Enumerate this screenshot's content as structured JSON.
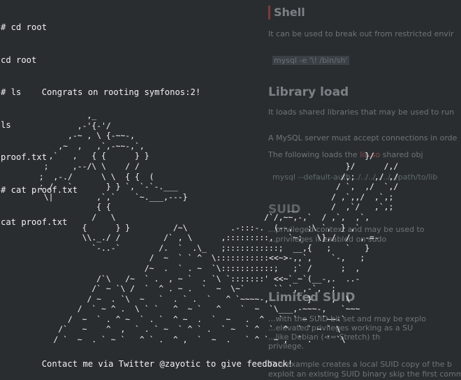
{
  "background_doc": {
    "shell_heading": "Shell",
    "shell_text": "It can be used to break out from restricted envir",
    "shell_code": "mysql -e '\\! /bin/sh'",
    "library_heading": "Library load",
    "library_text": "It loads shared libraries that may be used to run",
    "library_text2": "A MySQL server must accept connections in orde",
    "library_text3a": "The following loads the ",
    "library_text3b": "shared obj",
    "library_text3b_code": "lib.so",
    "library_code": "mysql --default-auth ../../../../../../path/to/lib",
    "suid_heading": "SUID",
    "suid_text": "...privileged context and may be used to",
    "suid_text2": "...privileges if enabled on sudo",
    "limited_heading": "Limited SUID",
    "limited_text1": "...with the SUID bit set and may be explo",
    "limited_text2": "...elevated privileges working as a SU",
    "limited_text3": "...like Debian (<= Stretch) th",
    "limited_text4": "privilege.",
    "limited_text5": "This example creates a local SUID copy of the b",
    "limited_text6": "exploit an existing SUID binary skip the first comm"
  },
  "terminal": {
    "lines": [
      "# cd root",
      "cd root",
      "# ls",
      "ls",
      "proof.txt",
      "# cat proof.txt",
      "cat proof.txt"
    ],
    "congrats": "        Congrats on rooting symfonos:2!",
    "art": [
      "                  ,_",
      "                ,-'{-'/",
      "              ,-~ , \\ {-~~-,",
      "            ,~  ,   ,`,-~~-,`,",
      "          ,`   ,   { {      } }                                             }/",
      "         ;     ,--/\\ \\    / /                                           }/      /,/",
      "        ;  ,-./      \\ \\  { {  (                                       /,;    ,/ ,/",
      "        ; /   `       } } `, `-`-.___                                 / `,  ,/  `,/",
      "         \\|         ,`,`    `~.___,---}                              / ,`,,/  ,`,;",
      "                    { {                                     __       /  ,`/   ,`,;",
      "                   /   \\                               /`/,~~,-,`  / ,`,  ,`,",
      "                 {      } }         /~\\         .-:::-.  (--,   ;\\ `,  } ,`",
      "                 \\\\._./ /         /` , \\      ,:::::::::,   `~;   \\},/  /  ,-=-",
      "                   `-..-`        /.  `  .\\_   ;:::::::::::;  __,{   ;   `   }",
      "                               /  ~  ` ` ^  \\:::::::::::<<~>-,,`,    `-,   ;",
      "                              /~  .  ` . ~  `\\:::::::::::;   ;` /      ;  ,",
      "                    /`\\   /~  ` .  , ~ `  . `\\ `:::::::' <<~`_~`(__-,.  ..-",
      "                   /` ~ `\\ /  `  ^ . ~ .  `  ~  \\~`      `` `,_,-`,  ;",
      "                  / ~  . `\\  ~   `  . ` .  `   ^ `~~~~-,        }    ,  \\",
      "                /  ` ~ ^ .  \\ ` `   ^  ~ `   ^    `  ~  `\\___,-~~~-,   `~~~",
      "              /  ~  ` . ^ ~  ` . `  ^ ~  .  `  ~   .  ^   `  ` ~  ``~~-`",
      "            /`   ~    ^  ,  ` . ` ~  ` ^ ` .  ` ~  ` ^  `  ^  ` ` ~ ` \\",
      "           / `  ~  . ` ~ `   ^ ` .  ^ ,  `  ~  .   ` ^ ` ~ ,  ` .   ` `\\"
    ],
    "contact": "        Contact me via Twitter @zayotic to give feedback!"
  }
}
